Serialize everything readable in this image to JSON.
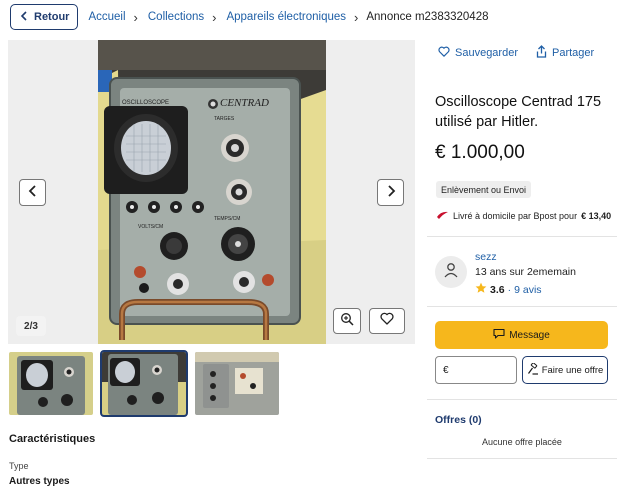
{
  "breadcrumb": {
    "back_label": "Retour",
    "items": [
      "Accueil",
      "Collections",
      "Appareils électroniques"
    ],
    "current": "Annonce m2383320428"
  },
  "gallery": {
    "counter": "2/3",
    "photo_panel_text": [
      "OSCILLOSCOPE",
      "CENTRAD",
      "TARGES",
      "VOLTS/CM",
      "TEMPS/CM"
    ]
  },
  "listing": {
    "title": "Oscilloscope Centrad 175 utilisé par Hitler.",
    "price": "€ 1.000,00",
    "delivery_badge": "Enlèvement ou Envoi",
    "shipping_text": "Livré à domicile par Bpost pour",
    "shipping_price": "€ 13,40"
  },
  "actions": {
    "save_label": "Sauvegarder",
    "share_label": "Partager"
  },
  "seller": {
    "name": "sezz",
    "since": "13 ans sur 2ememain",
    "rating": "3.6",
    "reviews_sep": " · ",
    "reviews": "9 avis"
  },
  "contact": {
    "message_label": "Message",
    "currency_symbol": "€",
    "offer_label": "Faire une offre"
  },
  "offers": {
    "title": "Offres (0)",
    "empty_text": "Aucune offre placée"
  },
  "details": {
    "section_title": "Caractéristiques",
    "type_label": "Type",
    "type_value": "Autres types"
  },
  "colors": {
    "primary": "#1f3b6e",
    "link": "#1f5fa6",
    "message_button": "#f6b71c",
    "rating_star": "#f6b71c",
    "bpost_logo": "#c8102e"
  }
}
